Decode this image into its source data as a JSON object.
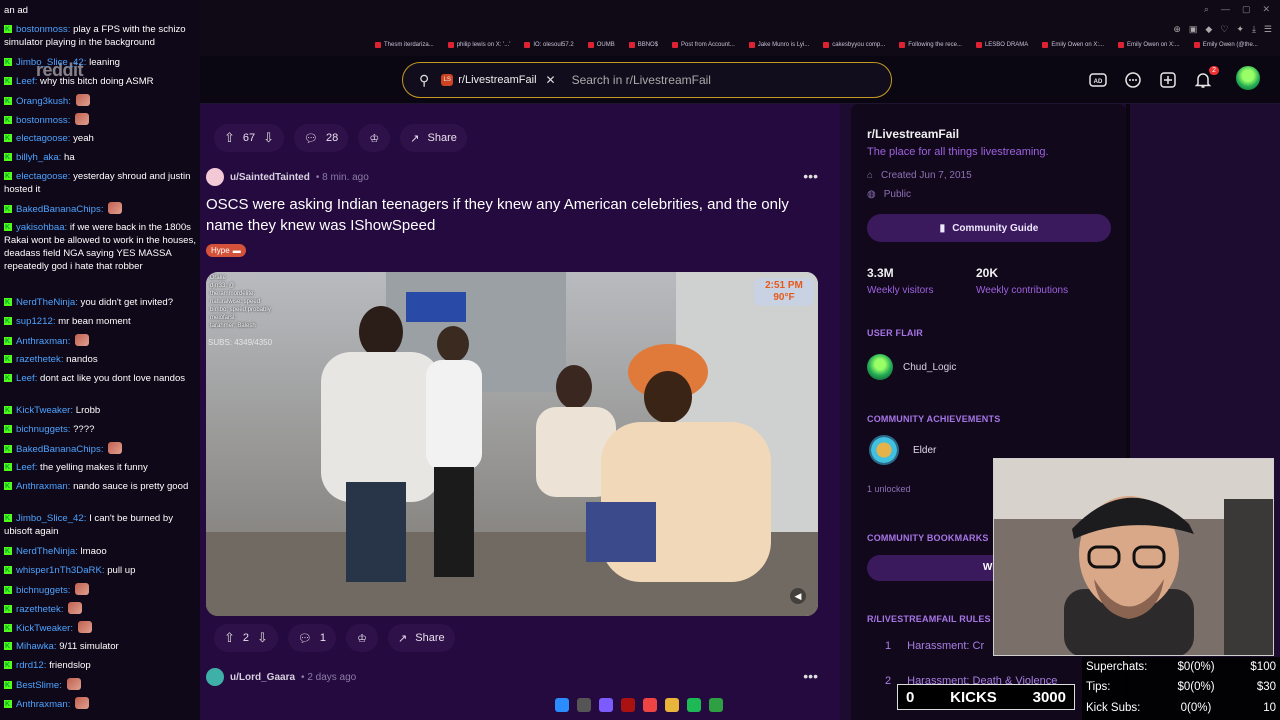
{
  "browser": {
    "bookmarks": [
      "Thesm iterdariza...",
      "philip lewis on X: '...'",
      "IO: olesoul57.2",
      "OUMB",
      "BBNO$",
      "Post from Account...",
      "Jake Munro is Lyi...",
      "cakesbyyou comp...",
      "Following the rece...",
      "LESBO DRAMA",
      "Emily Owen on X:...",
      "Emily Owen on X:...",
      "Emily Owen (@the..."
    ]
  },
  "reddit": {
    "logo_text": "reddit",
    "search": {
      "subreddit_chip": "r/LivestreamFail",
      "chip_avatar": "LS",
      "placeholder": "Search in r/LivestreamFail"
    },
    "notifications_count": "2"
  },
  "feed": {
    "prev_post": {
      "votes": "67",
      "comments": "28",
      "share_label": "Share"
    },
    "post": {
      "author": "u/SaintedTainted",
      "time": "8 min. ago",
      "title": "OSCS were asking Indian teenagers if they knew any American celebrities, and the only name they knew was IShowSpeed",
      "flair": "Hype",
      "video_overlay": {
        "chat_lines": [
          "Drake",
          "djrr33: @",
          "therammordelite:",
          "naturalwise: speed",
          "bimbo: speed probably",
          "melofarsi:",
          "tarahmer: Balesh"
        ],
        "subs": "SUBS: 4349/4350",
        "time": "2:51 PM",
        "temp": "90°F",
        "sign": "2 2"
      },
      "votes": "2",
      "comments": "1",
      "share_label": "Share"
    },
    "next_post": {
      "author": "u/Lord_Gaara",
      "time": "2 days ago"
    }
  },
  "sidebar": {
    "title": "r/LivestreamFail",
    "description": "The place for all things livestreaming.",
    "created": "Created Jun 7, 2015",
    "visibility": "Public",
    "guide_button": "Community Guide",
    "stats": [
      {
        "value": "3.3M",
        "label": "Weekly visitors"
      },
      {
        "value": "20K",
        "label": "Weekly contributions"
      }
    ],
    "user_flair_heading": "USER FLAIR",
    "user_flair_name": "Chud_Logic",
    "achievements_heading": "COMMUNITY ACHIEVEMENTS",
    "achievement": "Elder",
    "achievements_count": "1 unlocked",
    "bookmarks_heading": "COMMUNITY BOOKMARKS",
    "bookmark_label": "Wi",
    "rules_heading": "R/LIVESTREAMFAIL RULES",
    "rules": [
      {
        "num": "1",
        "text": "Harassment: Cr"
      },
      {
        "num": "2",
        "text": "Harassment: Death & Violence"
      }
    ]
  },
  "chat": [
    {
      "user": "",
      "text": "an ad"
    },
    {
      "user": "bostonmoss",
      "text": "play a FPS with the schizo simulator playing in the background"
    },
    {
      "user": "Jimbo_Slice_42",
      "text": "leaning"
    },
    {
      "user": "Leef",
      "text": "why this bitch doing ASMR"
    },
    {
      "user": "Orang3kush",
      "text": ""
    },
    {
      "user": "bostonmoss",
      "text": ""
    },
    {
      "user": "electagoose",
      "text": "yeah"
    },
    {
      "user": "billyh_aka",
      "text": "ha"
    },
    {
      "user": "electagoose",
      "text": "yesterday shroud and justin hosted it"
    },
    {
      "user": "BakedBananaChips",
      "text": ""
    },
    {
      "user": "yakisohbaa",
      "text": "if we were back in the 1800s Rakai wont be allowed to work in the houses, deadass field NGA saying YES MASSA repeatedly god i hate that robber"
    },
    {
      "user": "NerdTheNinja",
      "text": "you didn't get invited?"
    },
    {
      "user": "sup1212",
      "text": "mr bean moment"
    },
    {
      "user": "Anthraxman",
      "text": ""
    },
    {
      "user": "razethetek",
      "text": "nandos"
    },
    {
      "user": "Leef",
      "text": "dont act like you dont love nandos"
    },
    {
      "user": "KickTweaker",
      "text": "Lrobb"
    },
    {
      "user": "bichnuggets",
      "text": "????"
    },
    {
      "user": "BakedBananaChips",
      "text": ""
    },
    {
      "user": "Leef",
      "text": "the yelling makes it funny"
    },
    {
      "user": "Anthraxman",
      "text": "nando sauce is pretty good"
    },
    {
      "user": "Jimbo_Slice_42",
      "text": "I can't be burned by ubisoft again"
    },
    {
      "user": "NerdTheNinja",
      "text": "lmaoo"
    },
    {
      "user": "whisper1nTh3DaRK",
      "text": "pull up"
    },
    {
      "user": "bichnuggets",
      "text": ""
    },
    {
      "user": "razethetek",
      "text": ""
    },
    {
      "user": "KickTweaker",
      "text": ""
    },
    {
      "user": "Mihawka",
      "text": "9/11 simulator"
    },
    {
      "user": "rdrd12",
      "text": "friendslop"
    },
    {
      "user": "BestSlime",
      "text": ""
    },
    {
      "user": "Anthraxman",
      "text": ""
    }
  ],
  "stream": {
    "kicks_count": "0",
    "kicks_label": "KICKS",
    "kicks_goal": "3000",
    "superchats_label": "Superchats:",
    "superchats_value": "$0(0%)",
    "superchats_goal": "$100",
    "tips_label": "Tips:",
    "tips_value": "$0(0%)",
    "tips_goal": "$30",
    "kicksubs_label": "Kick Subs:",
    "kicksubs_value": "0(0%)",
    "kicksubs_goal": "10"
  },
  "colors": {
    "accent": "#9e62e0",
    "search_border": "#c49a23",
    "kick_green": "#53fc18",
    "chat_user": "#4da3ff"
  }
}
